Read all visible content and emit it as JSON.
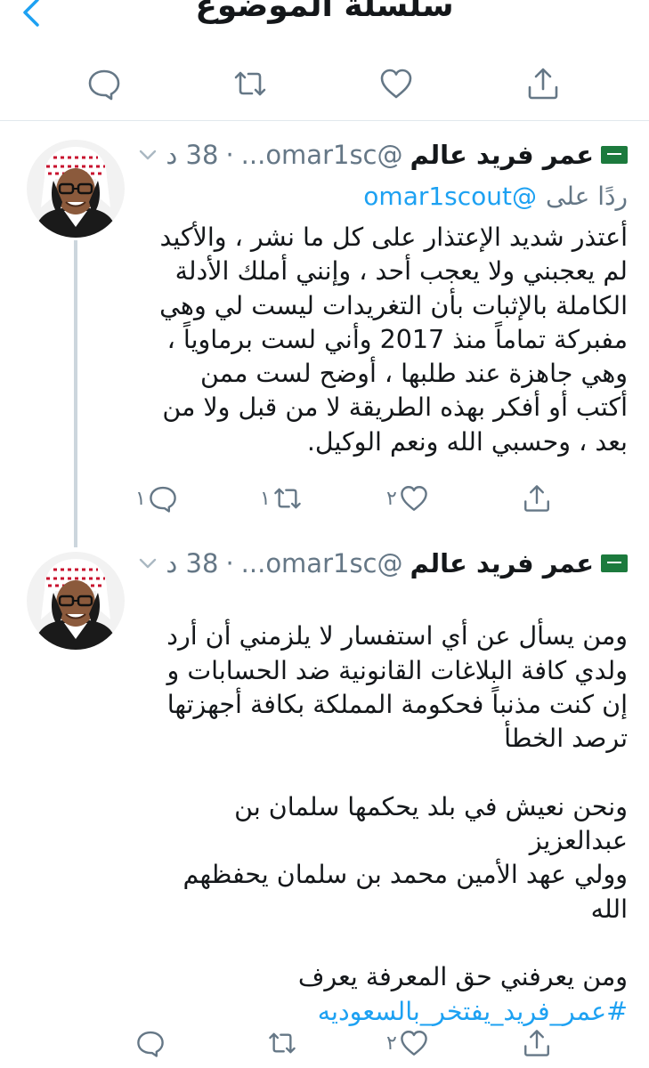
{
  "header": {
    "title": "سلسلة الموضوع"
  },
  "action_bar": {
    "icons": [
      "reply-icon",
      "retweet-icon",
      "like-icon",
      "share-icon"
    ]
  },
  "tweets": [
    {
      "name": "عمر فريد عالم",
      "handle": "@omar1sc...",
      "time": "38 د",
      "reply_label": "ردًا على",
      "reply_mention": "@omar1scout",
      "text": "أعتذر شديد الإعتذار على كل ما نشر ، والأكيد\nلم يعجبني ولا يعجب أحد ، وإنني أملك الأدلة\nالكاملة بالإثبات بأن التغريدات ليست لي وهي\nمفبركة تماماً منذ 2017 وأني لست برماوياً ،\nوهي جاهزة عند طلبها ، أوضح لست ممن\nأكتب أو أفكر بهذه الطريقة لا من قبل ولا من\nبعد ، وحسبي الله ونعم الوكيل.",
      "reply_count": "١",
      "retweet_count": "١",
      "like_count": "٢"
    },
    {
      "name": "عمر فريد عالم",
      "handle": "@omar1sc...",
      "time": "38 د",
      "text": "ومن يسأل عن أي استفسار لا يلزمني أن أرد\nولدي كافة البلاغات القانونية ضد الحسابات و\nإن كنت مذنباً فحكومة المملكة بكافة أجهزتها\nترصد الخطأ\n\nونحن نعيش في بلد يحكمها سلمان بن\nعبدالعزيز\nوولي عهد الأمين محمد بن سلمان يحفظهم\nالله\n\nومن يعرفني حق المعرفة يعرف",
      "hashtag": "#عمر_فريد_يفتخر_بالسعوديه",
      "like_count": "٢"
    }
  ],
  "colors": {
    "accent": "#1da1f2",
    "secondary_text": "#657786",
    "divider": "#e1e8ed",
    "thread_line": "#ccd6dd",
    "flag_green": "#1c7a3d"
  }
}
